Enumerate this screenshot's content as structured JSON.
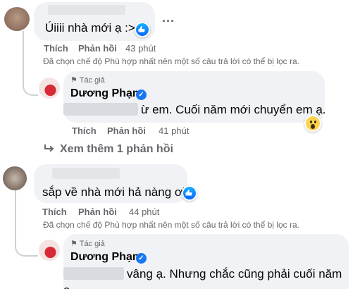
{
  "comments": [
    {
      "text": "Úiiii nhà mới ạ :>",
      "like": "Thích",
      "reply": "Phản hồi",
      "time": "43 phút",
      "more_options": "···",
      "filter_note": "Đã chọn chế độ Phù hợp nhất nên một số câu trả lời có thể bị lọc ra."
    },
    {
      "text": "sắp về nhà mới hả nàng ơi",
      "like": "Thích",
      "reply": "Phản hồi",
      "time": "44 phút",
      "filter_note": "Đã chọn chế độ Phù hợp nhất nên một số câu trả lời có thể bị lọc ra."
    }
  ],
  "replies": [
    {
      "badge": "Tác giả",
      "author": "Dương Phạm",
      "text": "ừ em. Cuối năm mới chuyển em ạ.",
      "like": "Thích",
      "reply": "Phản hồi",
      "time": "41 phút"
    },
    {
      "badge": "Tác giả",
      "author": "Dương Phạm",
      "text_line1": "vâng ạ. Nhưng chắc cũng phải cuối năm",
      "text_line2": "ạ"
    }
  ],
  "view_more": "Xem thêm 1 phản hồi",
  "icons": {
    "like": "like-reaction-icon",
    "wow": "wow-reaction-icon",
    "verified": "verified-badge-icon",
    "reply_arrow": "reply-arrow-icon",
    "mic": "microphone-icon"
  },
  "colors": {
    "bubble": "#f0f2f5",
    "secondary_text": "#65676b",
    "facebook_blue": "#1877f2"
  }
}
